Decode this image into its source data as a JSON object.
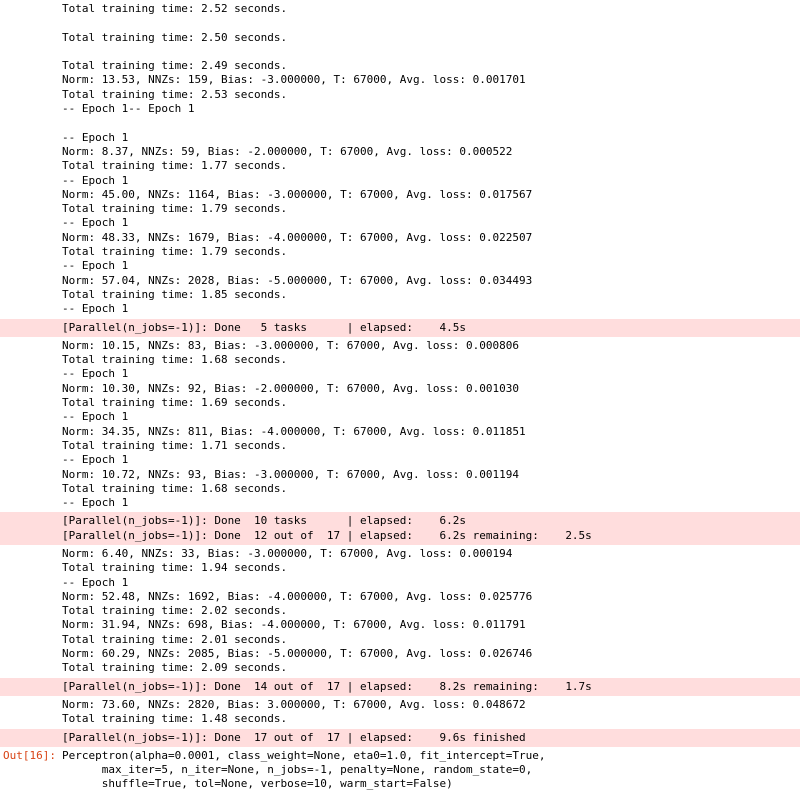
{
  "blocks": [
    {
      "type": "plain",
      "text": "Total training time: 2.52 seconds.\n\nTotal training time: 2.50 seconds.\n\nTotal training time: 2.49 seconds.\nNorm: 13.53, NNZs: 159, Bias: -3.000000, T: 67000, Avg. loss: 0.001701\nTotal training time: 2.53 seconds.\n-- Epoch 1-- Epoch 1\n\n-- Epoch 1\nNorm: 8.37, NNZs: 59, Bias: -2.000000, T: 67000, Avg. loss: 0.000522\nTotal training time: 1.77 seconds.\n-- Epoch 1\nNorm: 45.00, NNZs: 1164, Bias: -3.000000, T: 67000, Avg. loss: 0.017567\nTotal training time: 1.79 seconds.\n-- Epoch 1\nNorm: 48.33, NNZs: 1679, Bias: -4.000000, T: 67000, Avg. loss: 0.022507\nTotal training time: 1.79 seconds.\n-- Epoch 1\nNorm: 57.04, NNZs: 2028, Bias: -5.000000, T: 67000, Avg. loss: 0.034493\nTotal training time: 1.85 seconds.\n-- Epoch 1"
    },
    {
      "type": "stderr",
      "text": "[Parallel(n_jobs=-1)]: Done   5 tasks      | elapsed:    4.5s"
    },
    {
      "type": "plain",
      "text": "Norm: 10.15, NNZs: 83, Bias: -3.000000, T: 67000, Avg. loss: 0.000806\nTotal training time: 1.68 seconds.\n-- Epoch 1\nNorm: 10.30, NNZs: 92, Bias: -2.000000, T: 67000, Avg. loss: 0.001030\nTotal training time: 1.69 seconds.\n-- Epoch 1\nNorm: 34.35, NNZs: 811, Bias: -4.000000, T: 67000, Avg. loss: 0.011851\nTotal training time: 1.71 seconds.\n-- Epoch 1\nNorm: 10.72, NNZs: 93, Bias: -3.000000, T: 67000, Avg. loss: 0.001194\nTotal training time: 1.68 seconds.\n-- Epoch 1"
    },
    {
      "type": "stderr",
      "text": "[Parallel(n_jobs=-1)]: Done  10 tasks      | elapsed:    6.2s\n[Parallel(n_jobs=-1)]: Done  12 out of  17 | elapsed:    6.2s remaining:    2.5s"
    },
    {
      "type": "plain",
      "text": "Norm: 6.40, NNZs: 33, Bias: -3.000000, T: 67000, Avg. loss: 0.000194\nTotal training time: 1.94 seconds.\n-- Epoch 1\nNorm: 52.48, NNZs: 1692, Bias: -4.000000, T: 67000, Avg. loss: 0.025776\nTotal training time: 2.02 seconds.\nNorm: 31.94, NNZs: 698, Bias: -4.000000, T: 67000, Avg. loss: 0.011791\nTotal training time: 2.01 seconds.\nNorm: 60.29, NNZs: 2085, Bias: -5.000000, T: 67000, Avg. loss: 0.026746\nTotal training time: 2.09 seconds."
    },
    {
      "type": "stderr",
      "text": "[Parallel(n_jobs=-1)]: Done  14 out of  17 | elapsed:    8.2s remaining:    1.7s"
    },
    {
      "type": "plain",
      "text": "Norm: 73.60, NNZs: 2820, Bias: 3.000000, T: 67000, Avg. loss: 0.048672\nTotal training time: 1.48 seconds."
    },
    {
      "type": "stderr",
      "text": "[Parallel(n_jobs=-1)]: Done  17 out of  17 | elapsed:    9.6s finished"
    }
  ],
  "output": {
    "prompt": "Out[16]:",
    "repr": "Perceptron(alpha=0.0001, class_weight=None, eta0=1.0, fit_intercept=True,\n      max_iter=5, n_iter=None, n_jobs=-1, penalty=None, random_state=0,\n      shuffle=True, tol=None, verbose=10, warm_start=False)"
  }
}
